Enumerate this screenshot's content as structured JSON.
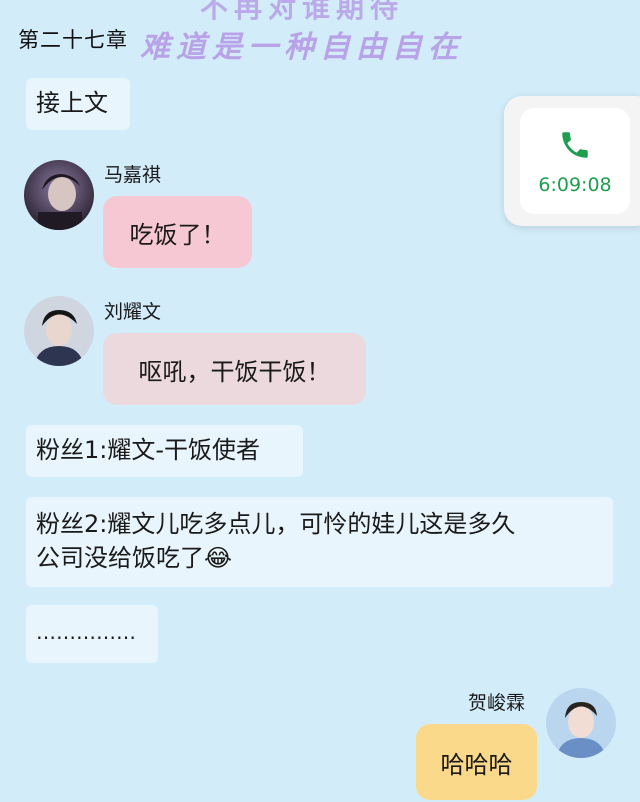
{
  "header": {
    "chapter_title": "第二十七章",
    "banner_top": "不再对谁期待",
    "banner_main": "难道是一种自由自在"
  },
  "call_widget": {
    "icon": "phone-icon",
    "time": "6:09:08",
    "accent": "#1e9e4e"
  },
  "messages": [
    {
      "type": "plain",
      "text": "接上文"
    },
    {
      "type": "chat",
      "speaker": "马嘉祺",
      "text": "吃饭了！",
      "bubble_color": "#f6c8d4"
    },
    {
      "type": "chat",
      "speaker": "刘耀文",
      "text": "呕吼，干饭干饭！",
      "bubble_color": "#ecd9de"
    },
    {
      "type": "plain",
      "text": "粉丝1:耀文-干饭使者"
    },
    {
      "type": "plain",
      "lines": [
        "粉丝2:耀文儿吃多点儿，可怜的娃儿这是多久",
        "公司没给饭吃了"
      ],
      "emoji": "😂"
    },
    {
      "type": "plain",
      "text": "……………"
    },
    {
      "type": "chat",
      "speaker": "贺峻霖",
      "text": "哈哈哈",
      "bubble_color": "#fbd98a"
    }
  ],
  "colors": {
    "background": "#d3ecfa",
    "plain_bubble": "#e9f5fc",
    "banner_text": "#b9a3e8"
  }
}
